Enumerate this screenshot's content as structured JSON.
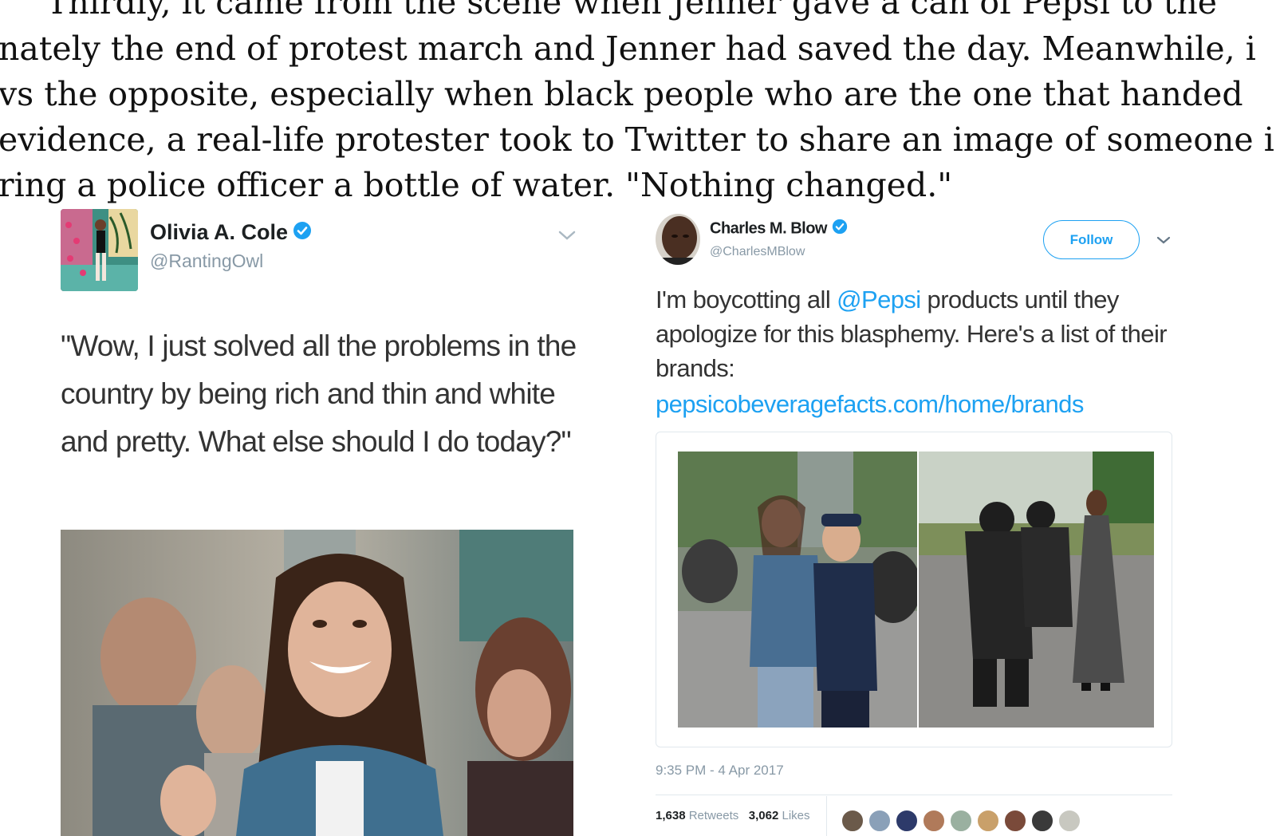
{
  "document": {
    "lines": [
      "Thirdly, it came from the scene when Jenner gave a can of Pepsi to the",
      "nately the end of protest march and Jenner had saved the day. Meanwhile, i",
      "vs the opposite, especially when black people who are the one that handed",
      "evidence, a real-life protester took to Twitter to share an image of someone i",
      "ring a police officer a bottle of water. \"Nothing changed.\""
    ]
  },
  "tweet_left": {
    "name": "Olivia A. Cole",
    "handle": "@RantingOwl",
    "text": "\"Wow, I just solved all the problems in the country by being rich and thin and white and pretty. What else should I do today?\""
  },
  "tweet_right": {
    "name": "Charles M. Blow",
    "handle": "@CharlesMBlow",
    "follow_label": "Follow",
    "text_before": "I'm boycotting all ",
    "mention": "@Pepsi",
    "text_after": " products until they apologize for this blasphemy. Here's a list of their brands:",
    "link": "pepsicobeveragefacts.com/home/brands",
    "timestamp": "9:35 PM - 4 Apr 2017",
    "retweets_count": "1,638",
    "retweets_label": "Retweets",
    "likes_count": "3,062",
    "likes_label": "Likes"
  },
  "colors": {
    "twitter_blue": "#1da1f2",
    "verified_blue": "#1da1f2",
    "muted_gray": "#8899a6"
  }
}
